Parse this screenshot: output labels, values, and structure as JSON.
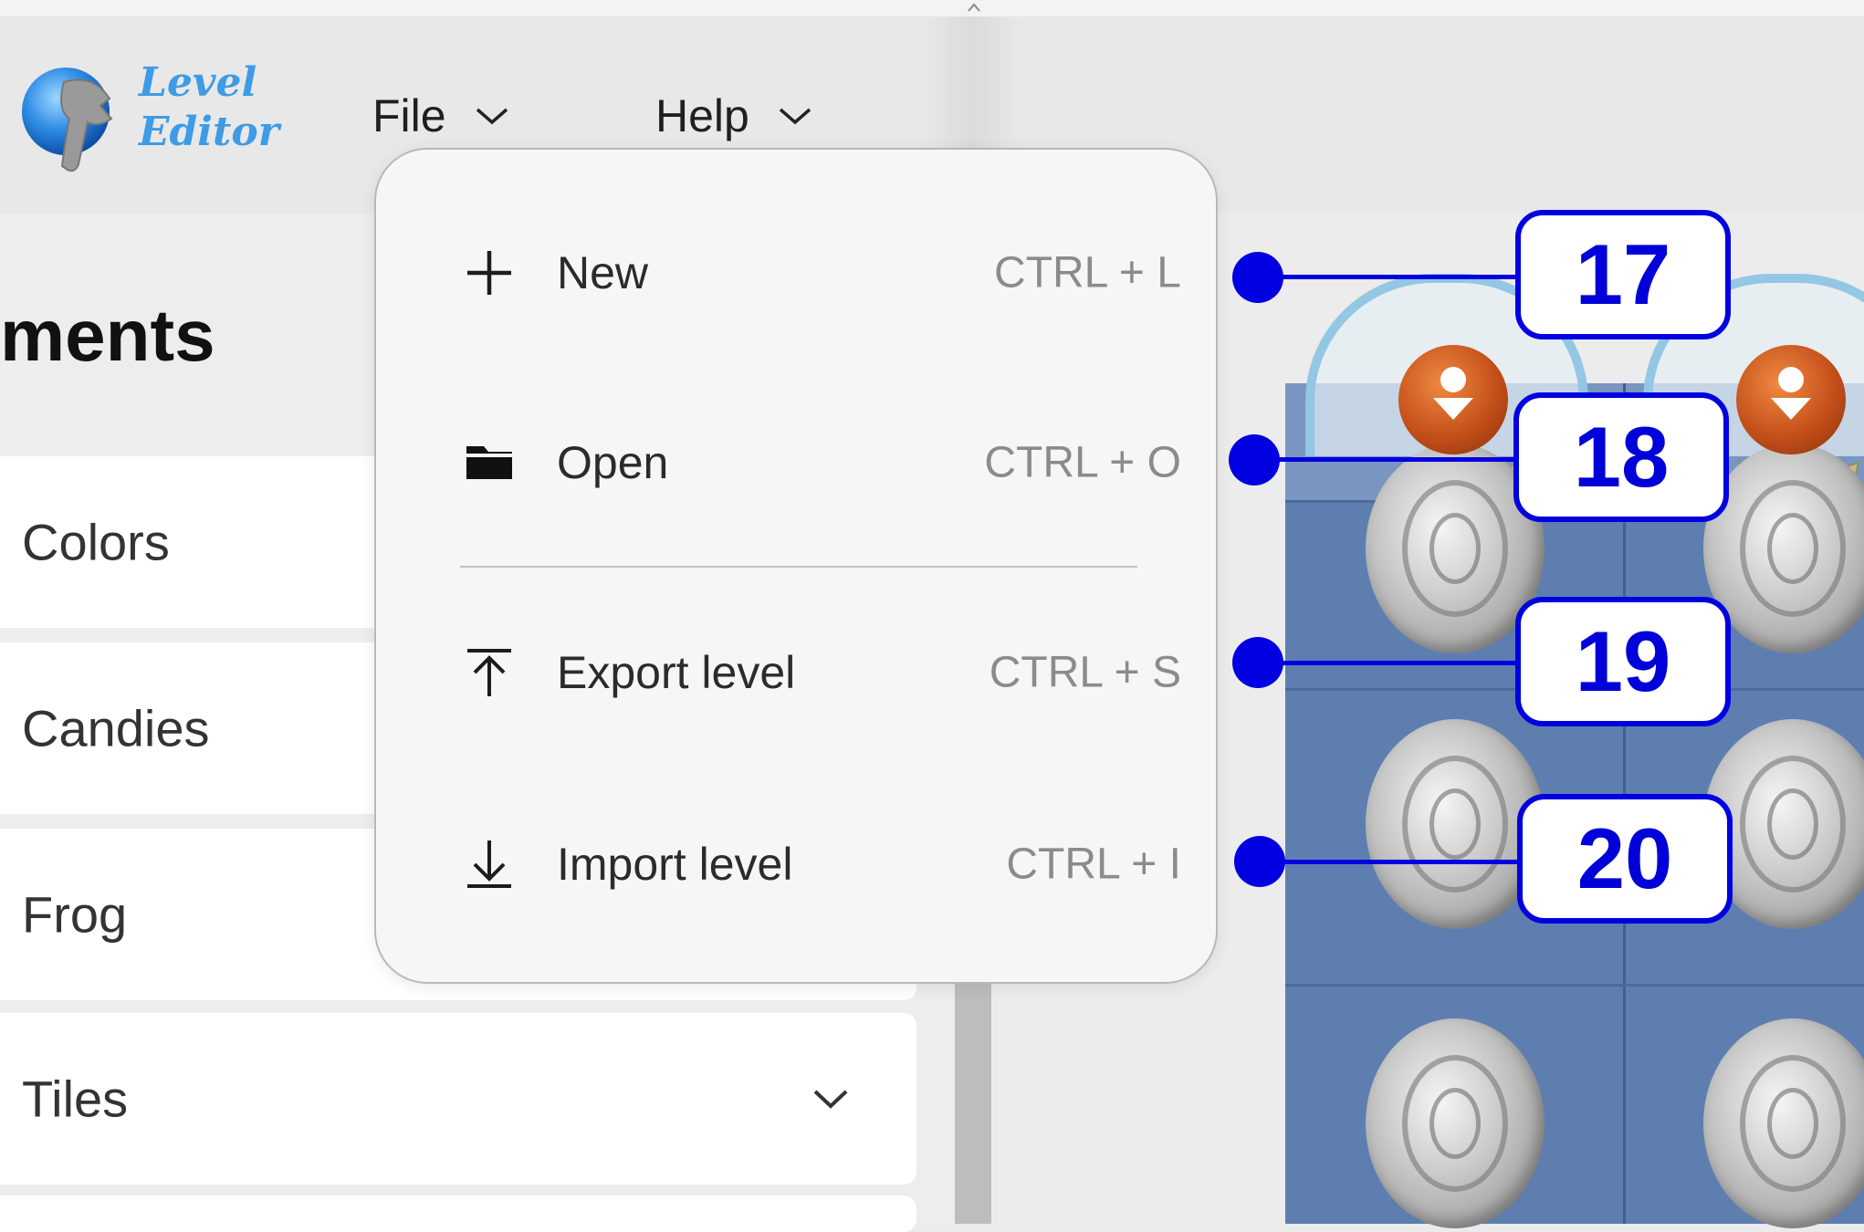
{
  "app": {
    "logo_line1": "Level",
    "logo_line2": "Editor"
  },
  "menubar": {
    "file": "File",
    "help": "Help"
  },
  "sidebar": {
    "title": "ments",
    "items": [
      {
        "label": "Colors"
      },
      {
        "label": "Candies"
      },
      {
        "label": "Frog"
      },
      {
        "label": "Tiles"
      }
    ]
  },
  "file_menu": {
    "items": [
      {
        "label": "New",
        "shortcut": "CTRL + L",
        "icon": "plus-icon"
      },
      {
        "label": "Open",
        "shortcut": "CTRL + O",
        "icon": "folder-icon"
      },
      {
        "label": "Export level",
        "shortcut": "CTRL + S",
        "icon": "export-icon"
      },
      {
        "label": "Import level",
        "shortcut": "CTRL + I",
        "icon": "import-icon"
      }
    ]
  },
  "callouts": [
    "17",
    "18",
    "19",
    "20"
  ],
  "colors": {
    "callout": "#0000e0",
    "board": "#5e7eb0",
    "logo": "#3e9be6"
  }
}
